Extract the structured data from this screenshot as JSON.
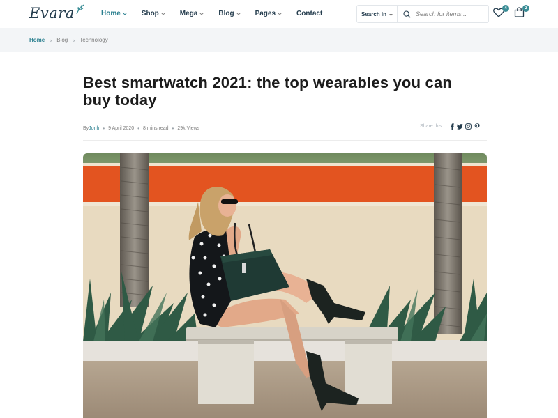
{
  "header": {
    "logo_text": "Evara",
    "nav": [
      {
        "label": "Home",
        "active": true,
        "dropdown": true
      },
      {
        "label": "Shop",
        "active": false,
        "dropdown": true
      },
      {
        "label": "Mega",
        "active": false,
        "dropdown": true
      },
      {
        "label": "Blog",
        "active": false,
        "dropdown": true
      },
      {
        "label": "Pages",
        "active": false,
        "dropdown": true
      },
      {
        "label": "Contact",
        "active": false,
        "dropdown": false
      }
    ],
    "search": {
      "category_label": "Search in",
      "placeholder": "Search for items..."
    },
    "wishlist_count": "4",
    "cart_count": "2"
  },
  "breadcrumb": [
    "Home",
    "Blog",
    "Technology"
  ],
  "article": {
    "title": "Best smartwatch 2021: the top wearables you can buy today",
    "author_prefix": "By ",
    "author": "Jonh",
    "date": "9 April 2020",
    "read_time": "8 mins read",
    "views": "29k Views",
    "share_label": "Share this:",
    "share_icons": [
      "facebook-icon",
      "twitter-icon",
      "instagram-icon",
      "pinterest-icon"
    ]
  },
  "colors": {
    "accent": "#2a7f8f",
    "badge": "#3a8d96",
    "heading": "#1c1c1c",
    "breadcrumb_bg": "#f3f5f7"
  }
}
